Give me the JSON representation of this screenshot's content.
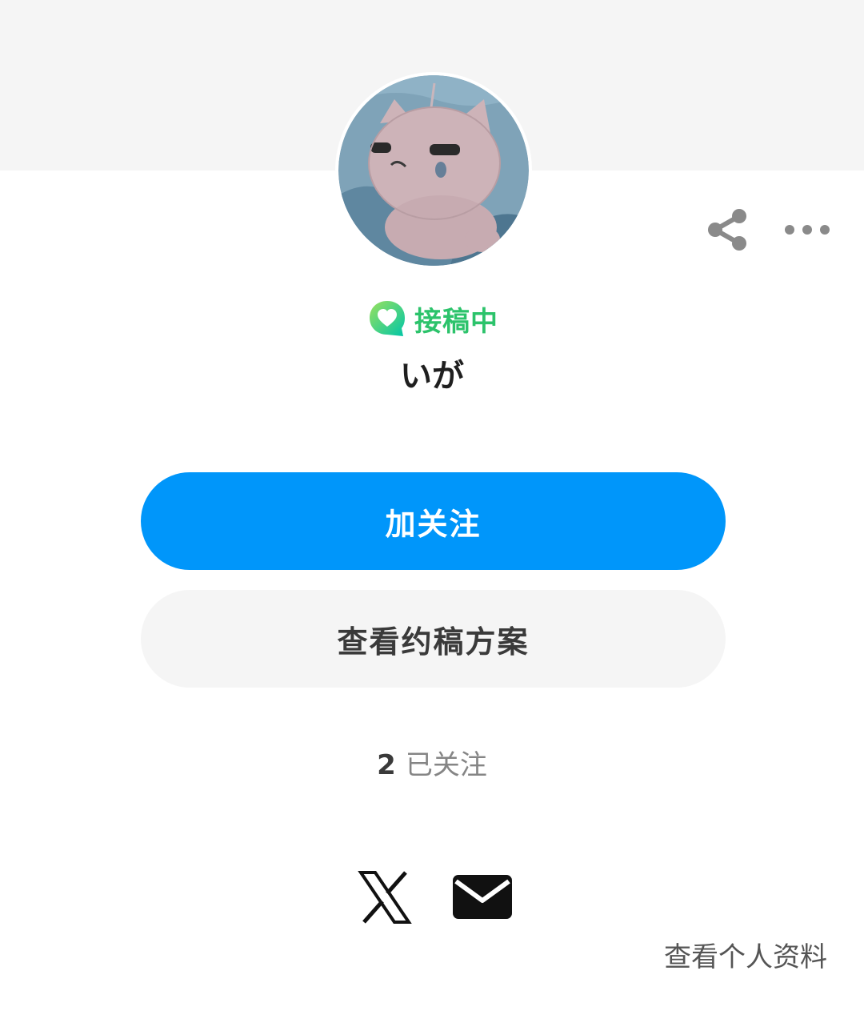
{
  "profile": {
    "avatar_icon": "avatar-pink-cat-image",
    "commission_status": "接稿中",
    "commission_icon": "request-heart-bubble-icon",
    "username": "いが"
  },
  "actions": {
    "share_icon": "share-icon",
    "more_icon": "more-horizontal-icon",
    "follow_label": "加关注",
    "plans_label": "查看约稿方案"
  },
  "stats": {
    "following_count": "2",
    "following_label": "已关注"
  },
  "social": {
    "x_icon": "x-logo-icon",
    "mail_icon": "mail-icon"
  },
  "footer": {
    "view_profile_label": "查看个人资料"
  },
  "colors": {
    "follow_button": "#0096fa",
    "commission_green": "#2cc36b",
    "secondary_button": "#f5f5f5",
    "header_background": "#f5f5f5"
  }
}
